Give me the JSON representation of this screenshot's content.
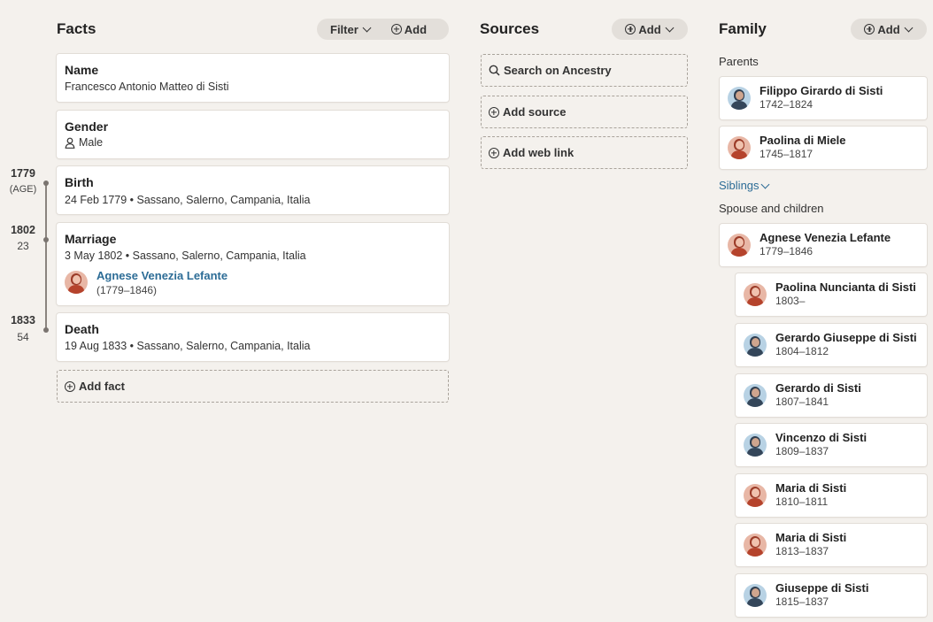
{
  "facts": {
    "heading": "Facts",
    "filter_label": "Filter",
    "add_label": "Add",
    "name": {
      "title": "Name",
      "value": "Francesco Antonio Matteo di Sisti"
    },
    "gender": {
      "title": "Gender",
      "value": "Male"
    },
    "birth": {
      "title": "Birth",
      "detail": "24 Feb 1779 • Sassano, Salerno, Campania, Italia"
    },
    "marriage": {
      "title": "Marriage",
      "detail": "3 May 1802 • Sassano, Salerno, Campania, Italia",
      "spouse_name": "Agnese Venezia Lefante",
      "spouse_dates": "(1779–1846)"
    },
    "death": {
      "title": "Death",
      "detail": "19 Aug 1833 • Sassano, Salerno, Campania, Italia"
    },
    "add_fact_label": "Add fact"
  },
  "timeline": [
    {
      "year": "1779",
      "age": "(AGE)"
    },
    {
      "year": "1802",
      "age": "23"
    },
    {
      "year": "1833",
      "age": "54"
    }
  ],
  "sources": {
    "heading": "Sources",
    "add_label": "Add",
    "search_label": "Search on Ancestry",
    "add_source_label": "Add source",
    "add_web_link_label": "Add web link"
  },
  "family": {
    "heading": "Family",
    "add_label": "Add",
    "parents_label": "Parents",
    "siblings_label": "Siblings",
    "spouse_children_label": "Spouse and children",
    "parents": [
      {
        "name": "Filippo Girardo di Sisti",
        "dates": "1742–1824",
        "gender": "male"
      },
      {
        "name": "Paolina di Miele",
        "dates": "1745–1817",
        "gender": "female"
      }
    ],
    "spouse": {
      "name": "Agnese Venezia Lefante",
      "dates": "1779–1846",
      "gender": "female"
    },
    "children": [
      {
        "name": "Paolina Nuncianta di Sisti",
        "dates": "1803–",
        "gender": "female"
      },
      {
        "name": "Gerardo Giuseppe di Sisti",
        "dates": "1804–1812",
        "gender": "male"
      },
      {
        "name": "Gerardo di Sisti",
        "dates": "1807–1841",
        "gender": "male"
      },
      {
        "name": "Vincenzo di Sisti",
        "dates": "1809–1837",
        "gender": "male"
      },
      {
        "name": "Maria di Sisti",
        "dates": "1810–1811",
        "gender": "female"
      },
      {
        "name": "Maria di Sisti",
        "dates": "1813–1837",
        "gender": "female"
      },
      {
        "name": "Giuseppe di Sisti",
        "dates": "1815–1837",
        "gender": "male"
      }
    ]
  },
  "colors": {
    "background": "#f4f1ed",
    "card": "#ffffff",
    "link": "#2c6c96",
    "pill": "#e3dfda"
  }
}
